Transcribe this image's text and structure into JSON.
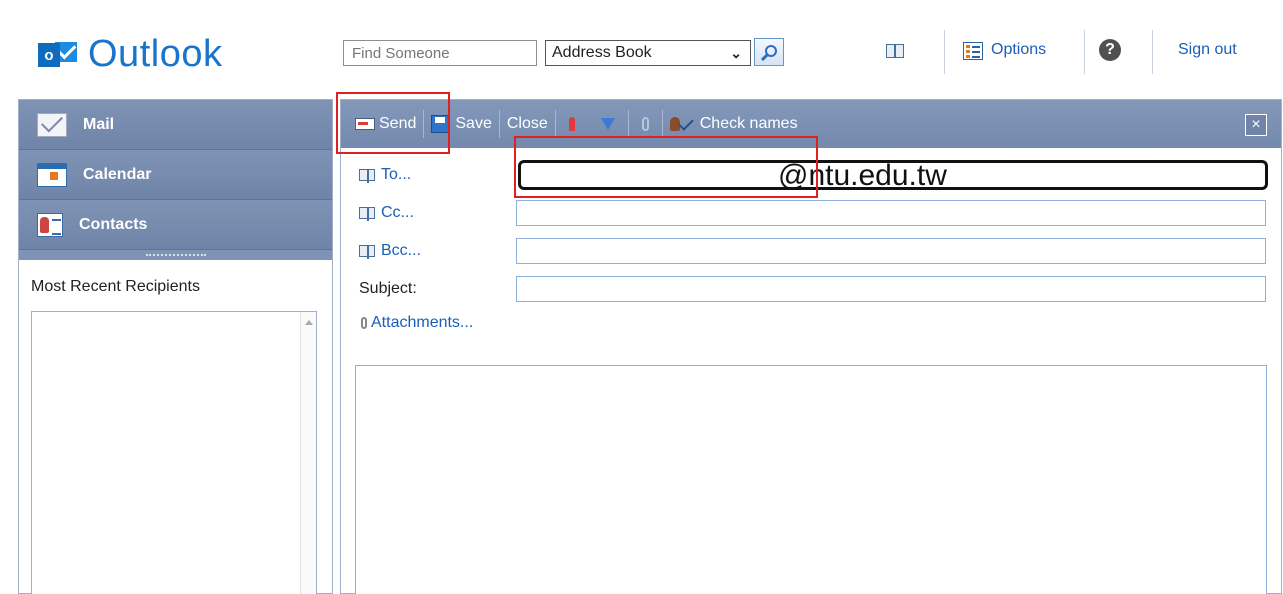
{
  "app": {
    "name": "Outlook",
    "logo_letter": "o",
    "brand_color": "#1874cd"
  },
  "header": {
    "find_placeholder": "Find Someone",
    "address_book_selected": "Address Book",
    "options_label": "Options",
    "help_symbol": "?",
    "sign_out_label": "Sign out"
  },
  "nav": {
    "items": [
      {
        "label": "Mail",
        "icon": "mail-icon"
      },
      {
        "label": "Calendar",
        "icon": "calendar-icon"
      },
      {
        "label": "Contacts",
        "icon": "contacts-icon"
      }
    ],
    "recent_recipients_label": "Most Recent Recipients"
  },
  "toolbar": {
    "send_label": "Send",
    "save_label": "Save",
    "close_label": "Close",
    "check_names_label": "Check names",
    "close_window_symbol": "×"
  },
  "compose": {
    "to_label": "To...",
    "to_value": "@ntu.edu.tw",
    "cc_label": "Cc...",
    "bcc_label": "Bcc...",
    "subject_label": "Subject:",
    "attachments_label": "Attachments..."
  },
  "colors": {
    "toolbar_bg": "#7f93b4",
    "link": "#1a5fb4",
    "highlight": "#e02020"
  }
}
